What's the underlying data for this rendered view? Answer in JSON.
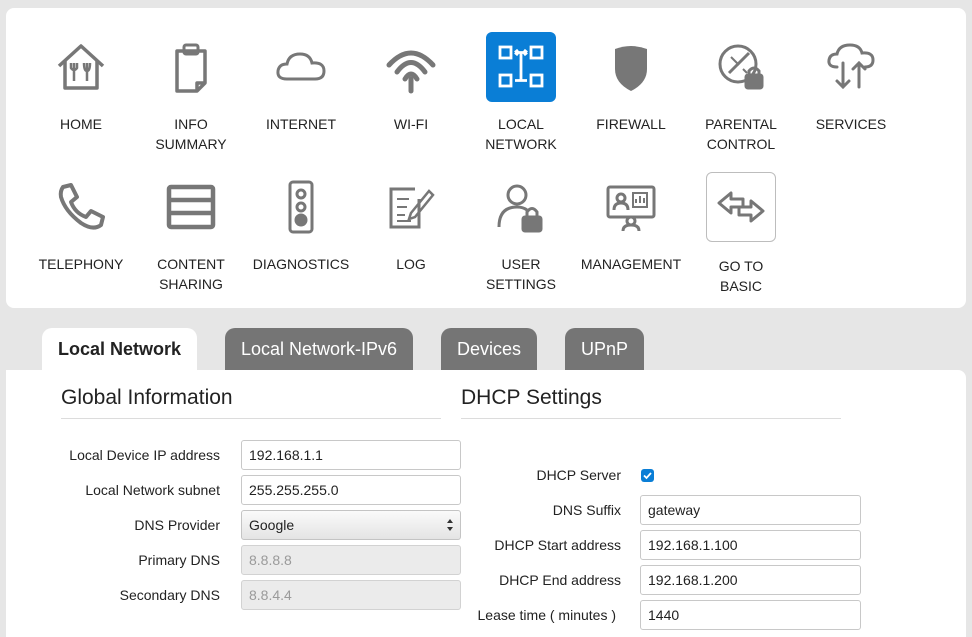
{
  "nav": {
    "items": [
      {
        "label": "HOME",
        "icon": "home-icon"
      },
      {
        "label": "INFO\nSUMMARY",
        "icon": "clipboard-icon"
      },
      {
        "label": "INTERNET",
        "icon": "cloud-icon"
      },
      {
        "label": "WI-FI",
        "icon": "wifi-icon"
      },
      {
        "label": "LOCAL\nNETWORK",
        "icon": "local-network-icon",
        "active": true
      },
      {
        "label": "FIREWALL",
        "icon": "shield-icon"
      },
      {
        "label": "PARENTAL\nCONTROL",
        "icon": "parental-lock-icon"
      },
      {
        "label": "SERVICES",
        "icon": "cloud-sync-icon"
      },
      {
        "label": "TELEPHONY",
        "icon": "phone-icon"
      },
      {
        "label": "CONTENT\nSHARING",
        "icon": "storage-icon"
      },
      {
        "label": "DIAGNOSTICS",
        "icon": "traffic-light-icon"
      },
      {
        "label": "LOG",
        "icon": "log-edit-icon"
      },
      {
        "label": "USER\nSETTINGS",
        "icon": "user-lock-icon"
      },
      {
        "label": "MANAGEMENT",
        "icon": "management-icon"
      },
      {
        "label": "GO TO\nBASIC",
        "icon": "swap-arrows-icon"
      }
    ]
  },
  "tabs": [
    {
      "label": "Local Network",
      "active": true
    },
    {
      "label": "Local Network-IPv6"
    },
    {
      "label": "Devices"
    },
    {
      "label": "UPnP"
    }
  ],
  "global_info": {
    "title": "Global Information",
    "local_ip_label": "Local Device IP address",
    "local_ip_value": "192.168.1.1",
    "subnet_label": "Local Network subnet",
    "subnet_value": "255.255.255.0",
    "dns_provider_label": "DNS Provider",
    "dns_provider_value": "Google",
    "primary_dns_label": "Primary DNS",
    "primary_dns_value": "8.8.8.8",
    "secondary_dns_label": "Secondary DNS",
    "secondary_dns_value": "8.8.4.4"
  },
  "dhcp": {
    "title": "DHCP Settings",
    "server_label": "DHCP Server",
    "server_enabled": true,
    "suffix_label": "DNS Suffix",
    "suffix_value": "gateway",
    "start_label": "DHCP Start address",
    "start_value": "192.168.1.100",
    "end_label": "DHCP End address",
    "end_value": "192.168.1.200",
    "lease_label": "Lease time ( minutes )",
    "lease_value": "1440"
  },
  "colors": {
    "accent": "#0a7ed6",
    "icon_gray": "#757575",
    "tab_inactive": "#757575",
    "background": "#e6e6e6"
  }
}
